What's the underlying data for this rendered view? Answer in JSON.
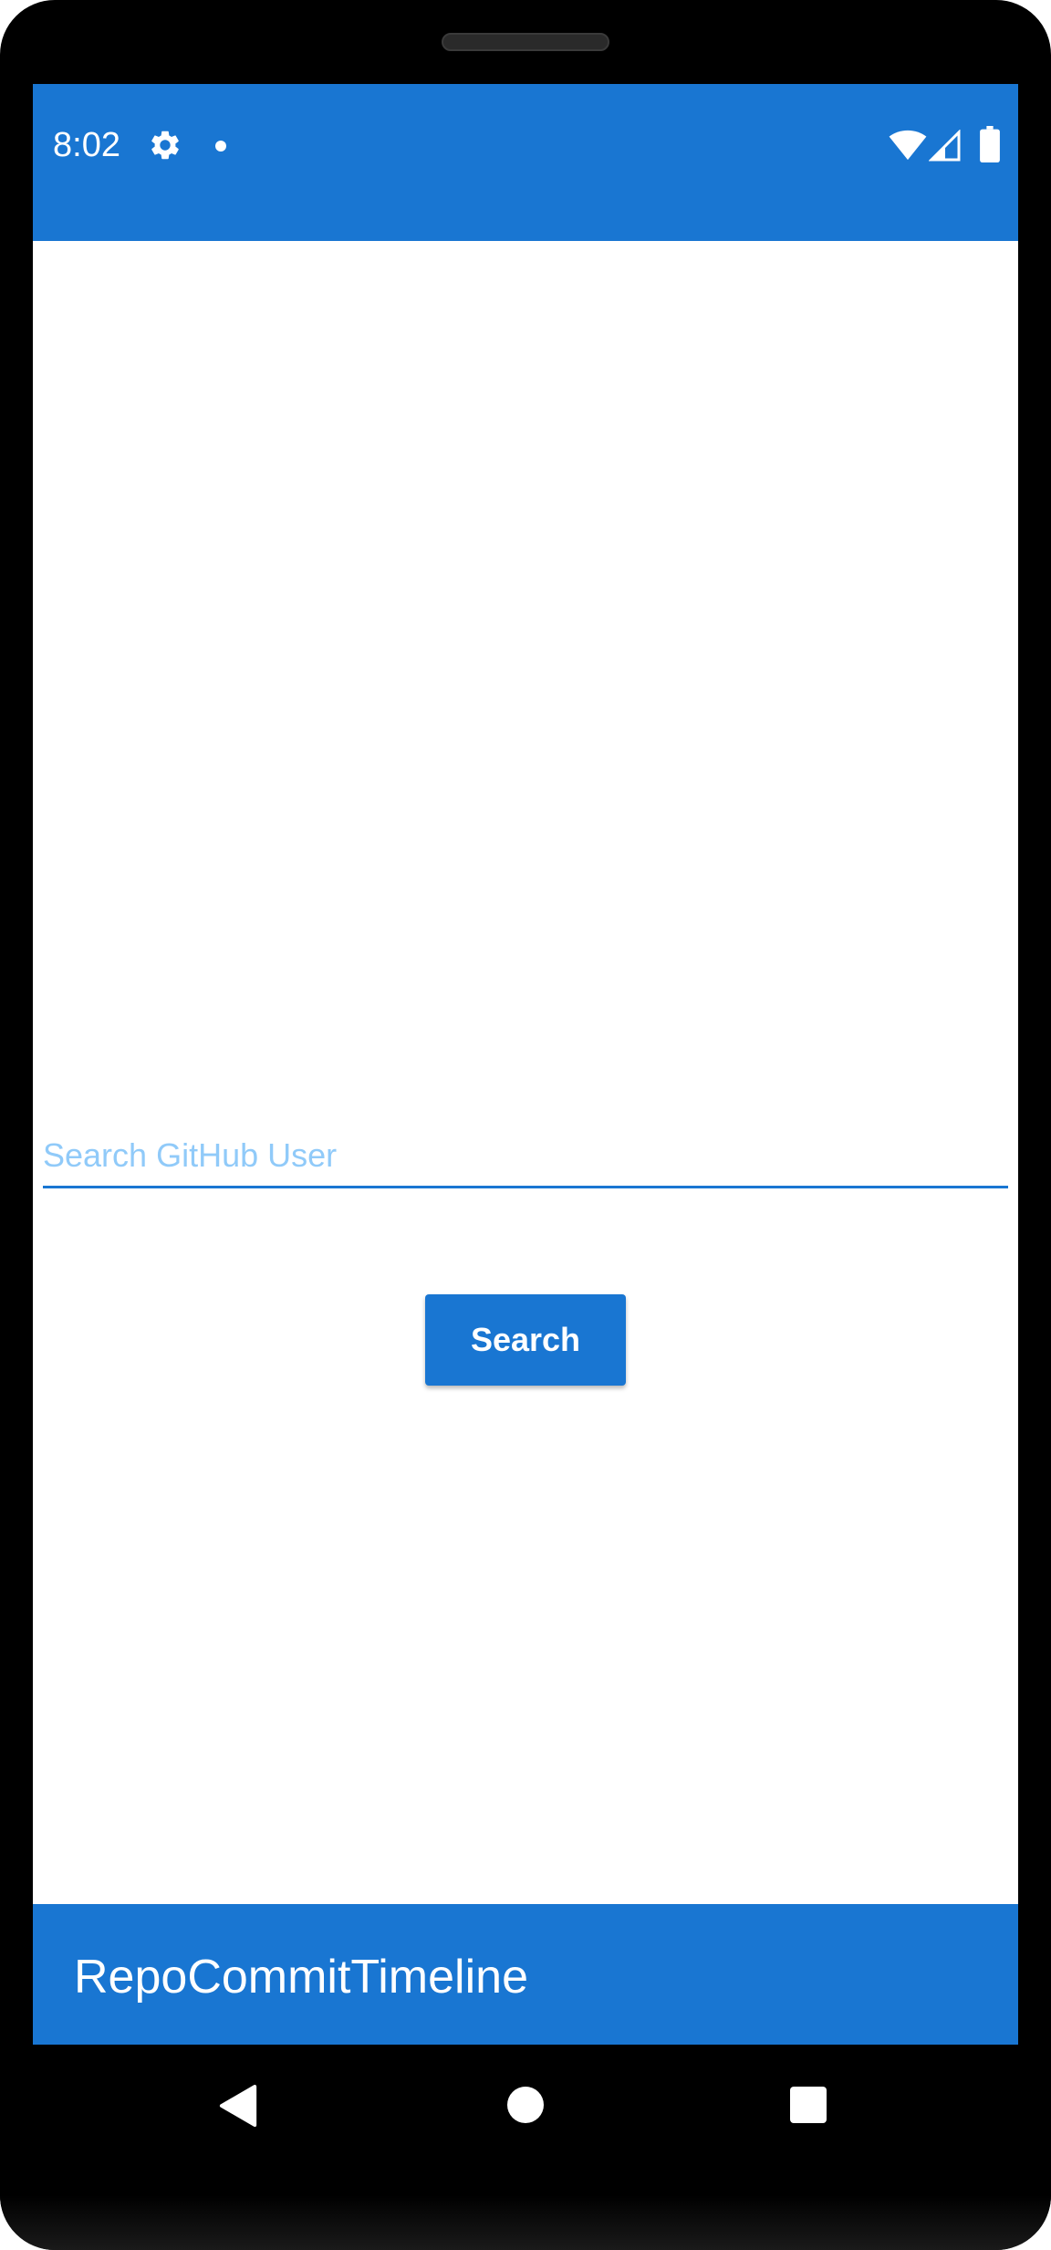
{
  "status_bar": {
    "time": "8:02",
    "icons": [
      "gear-icon",
      "notification-dot-icon",
      "wifi-icon",
      "signal-icon",
      "battery-icon"
    ]
  },
  "search": {
    "placeholder": "Search GitHub User",
    "value": "",
    "button_label": "Search"
  },
  "app_bar": {
    "title": "RepoCommitTimeline"
  },
  "nav_bar": {
    "icons": [
      "back-icon",
      "home-icon",
      "recents-icon"
    ]
  },
  "colors": {
    "primary": "#1976d2",
    "placeholder": "#90caf9",
    "background": "#ffffff"
  }
}
